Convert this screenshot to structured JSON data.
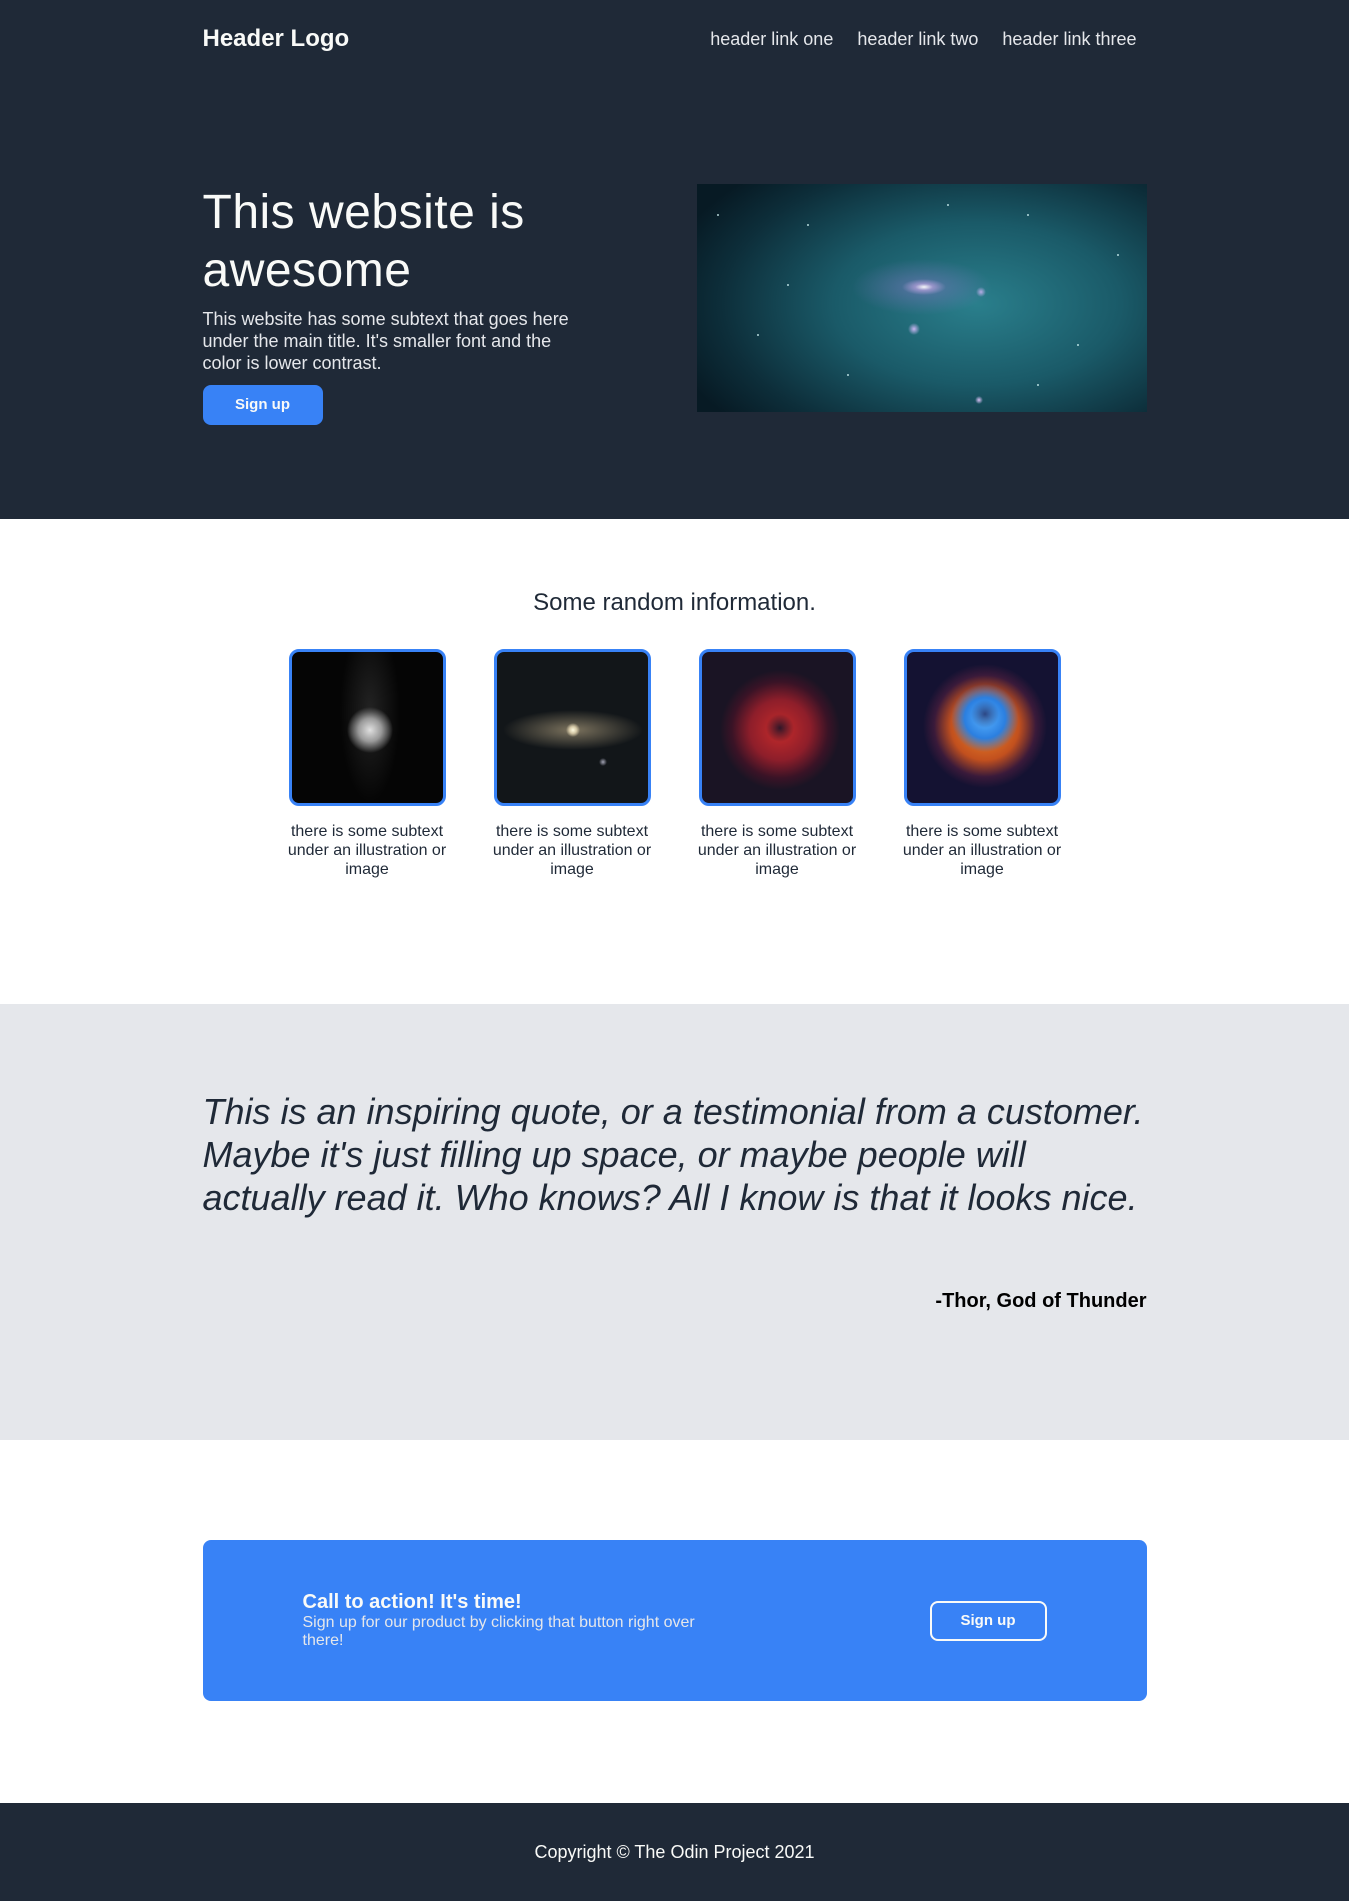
{
  "header": {
    "logo": "Header Logo",
    "links": [
      "header link one",
      "header link two",
      "header link three"
    ]
  },
  "hero": {
    "title": "This website is awesome",
    "subtext": "This website has some subtext that goes here under the main title. It's smaller font and the color is lower contrast.",
    "button_label": "Sign up"
  },
  "info": {
    "title": "Some random information.",
    "cards": [
      {
        "image": "moon",
        "text": "there is some subtext under an illustration or image"
      },
      {
        "image": "andromeda-galaxy",
        "text": "there is some subtext under an illustration or image"
      },
      {
        "image": "rosette-nebula-red",
        "text": "there is some subtext under an illustration or image"
      },
      {
        "image": "rosette-nebula-blue",
        "text": "there is some subtext under an illustration or image"
      }
    ]
  },
  "quote": {
    "text": "This is an inspiring quote, or a testimonial from a customer. Maybe it's just filling up space, or maybe people will actually read it. Who knows? All I know is that it looks nice.",
    "author": "-Thor, God of Thunder"
  },
  "cta": {
    "title": "Call to action! It's time!",
    "subtext": "Sign up for our product by clicking that button right over there!",
    "button_label": "Sign up"
  },
  "footer": {
    "copyright": "Copyright © The Odin Project 2021"
  },
  "colors": {
    "dark": "#1f2937",
    "accent": "#3882f6",
    "light_gray": "#e5e7eb",
    "off_white": "#f9faf8"
  }
}
